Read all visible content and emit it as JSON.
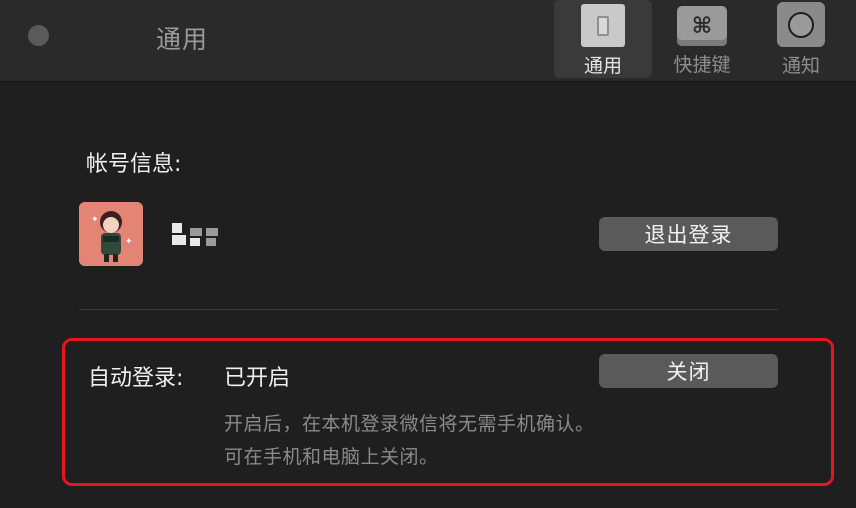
{
  "window": {
    "title": "通用"
  },
  "toolbar": {
    "tabs": [
      {
        "label": "通用",
        "icon": "switch-icon",
        "active": true
      },
      {
        "label": "快捷键",
        "icon": "command-key-icon",
        "symbol": "⌘",
        "active": false
      },
      {
        "label": "通知",
        "icon": "notification-icon",
        "active": false
      }
    ]
  },
  "account": {
    "section_title": "帐号信息:",
    "avatar": "avatar-image",
    "logout_label": "退出登录"
  },
  "auto_login": {
    "label": "自动登录:",
    "status": "已开启",
    "close_label": "关闭",
    "description_line1": "开启后，在本机登录微信将无需手机确认。",
    "description_line2": "可在手机和电脑上关闭。"
  },
  "colors": {
    "background": "#1f1f1f",
    "toolbar": "#2a2a2a",
    "button": "#5a5a5a",
    "highlight_border": "#e8141e",
    "avatar_bg": "#e07a6a"
  }
}
